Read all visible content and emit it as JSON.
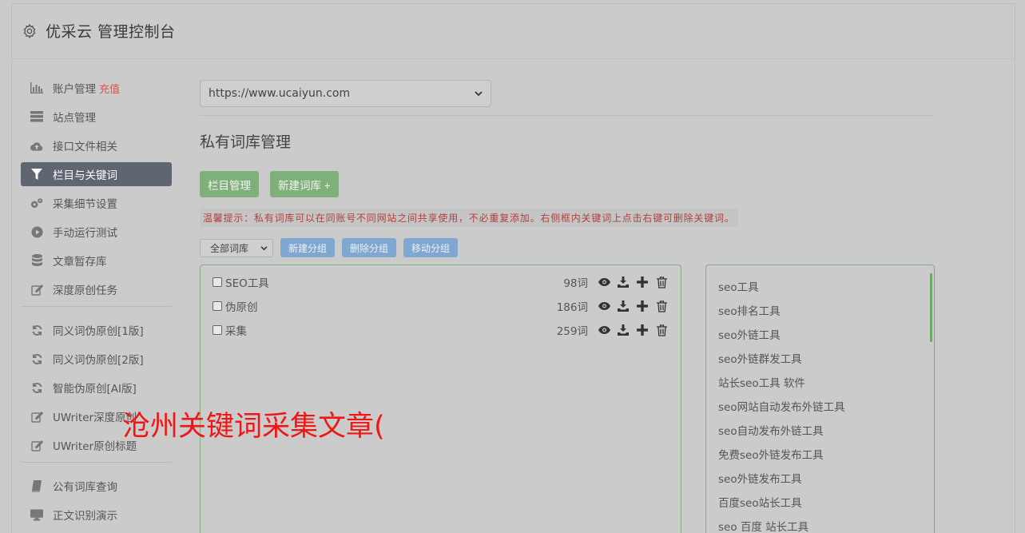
{
  "header": {
    "title": "优采云 管理控制台",
    "icon": "gear-icon"
  },
  "sidebar": {
    "group1": [
      {
        "label": "账户管理",
        "extra": "充值",
        "icon": "bar-chart-icon"
      },
      {
        "label": "站点管理",
        "icon": "server-icon"
      },
      {
        "label": "接口文件相关",
        "icon": "cloud-upload-icon"
      },
      {
        "label": "栏目与关键词",
        "icon": "filter-icon",
        "active": true
      },
      {
        "label": "采集细节设置",
        "icon": "gears-icon"
      },
      {
        "label": "手动运行测试",
        "icon": "play-circle-icon"
      },
      {
        "label": "文章暂存库",
        "icon": "database-icon"
      },
      {
        "label": "深度原创任务",
        "icon": "edit-icon"
      }
    ],
    "group2": [
      {
        "label": "同义词伪原创[1版]",
        "icon": "refresh-icon"
      },
      {
        "label": "同义词伪原创[2版]",
        "icon": "refresh-icon"
      },
      {
        "label": "智能伪原创[AI版]",
        "icon": "refresh-icon"
      },
      {
        "label": "UWriter深度原创",
        "icon": "edit-icon"
      },
      {
        "label": "UWriter原创标题",
        "icon": "edit-icon"
      }
    ],
    "group3": [
      {
        "label": "公有词库查询",
        "icon": "book-icon"
      },
      {
        "label": "正文识别演示",
        "icon": "monitor-icon"
      }
    ]
  },
  "main": {
    "site_select": "https://www.ucaiyun.com",
    "section_title": "私有词库管理",
    "btn_category": "栏目管理",
    "btn_new_lib": "新建词库 +",
    "tip": "温馨提示：私有词库可以在同账号不同网站之间共享使用，不必重复添加。右侧框内关键词上点击右键可删除关键词。",
    "group_select": "全部词库",
    "btn_new_group": "新建分组",
    "btn_delete_group": "删除分组",
    "btn_move_group": "移动分组"
  },
  "libraries": [
    {
      "name": "SEO工具",
      "count": "98词"
    },
    {
      "name": "伪原创",
      "count": "186词"
    },
    {
      "name": "采集",
      "count": "259词"
    }
  ],
  "keywords": [
    "seo工具",
    "seo排名工具",
    "seo外链工具",
    "seo外链群发工具",
    "站长seo工具 软件",
    "seo网站自动发布外链工具",
    "seo自动发布外链工具",
    "免费seo外链发布工具",
    "seo外链发布工具",
    "百度seo站长工具",
    "seo 百度 站长工具"
  ],
  "watermark": "沧州关键词采集文章(",
  "colors": {
    "active_nav": "#5f6571",
    "green_btn": "#7fb07a",
    "blue_btn": "#7fa7cf",
    "tip_text": "#b0413e",
    "watermark": "#f01616"
  }
}
